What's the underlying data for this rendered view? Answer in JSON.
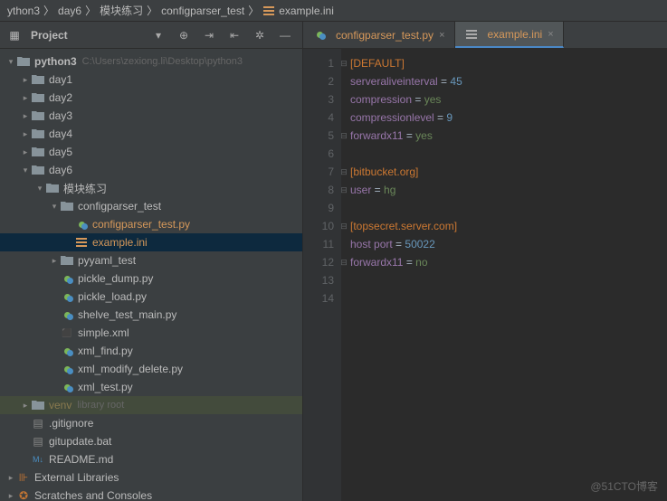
{
  "breadcrumb": {
    "items": [
      "ython3",
      "day6",
      "模块练习",
      "configparser_test"
    ],
    "active": "example.ini"
  },
  "sidebar": {
    "title": "Project",
    "root": {
      "name": "python3",
      "path": "C:\\Users\\zexiong.li\\Desktop\\python3"
    },
    "days": [
      "day1",
      "day2",
      "day3",
      "day4",
      "day5"
    ],
    "day6": "day6",
    "mod_folder": "模块练习",
    "cfg_folder": "configparser_test",
    "cfg_py": "configparser_test.py",
    "cfg_ini": "example.ini",
    "pyyaml": "pyyaml_test",
    "files": [
      "pickle_dump.py",
      "pickle_load.py",
      "shelve_test_main.py",
      "simple.xml",
      "xml_find.py",
      "xml_modify_delete.py",
      "xml_test.py"
    ],
    "venv": "venv",
    "venv_note": "library root",
    "dotfiles": [
      ".gitignore",
      "gitupdate.bat",
      "README.md"
    ],
    "ext_lib": "External Libraries",
    "scratches": "Scratches and Consoles"
  },
  "tabs": {
    "t1": "configparser_test.py",
    "t2": "example.ini"
  },
  "code": {
    "l1": {
      "section": "[DEFAULT]"
    },
    "l2": {
      "k": "serveraliveinterval",
      "eq": " = ",
      "v": "45"
    },
    "l3": {
      "k": "compression",
      "eq": " = ",
      "v": "yes"
    },
    "l4": {
      "k": "compressionlevel",
      "eq": " = ",
      "v": "9"
    },
    "l5": {
      "k": "forwardx11",
      "eq": " = ",
      "v": "yes"
    },
    "l7": {
      "section": "[bitbucket.org]"
    },
    "l8": {
      "k": "user",
      "eq": " = ",
      "v": "hg"
    },
    "l10": {
      "section": "[topsecret.server.com]"
    },
    "l11": {
      "k": "host port",
      "eq": " = ",
      "v": "50022"
    },
    "l12": {
      "k": "forwardx11",
      "eq": " = ",
      "v": "no"
    }
  },
  "gutter": [
    "1",
    "2",
    "3",
    "4",
    "5",
    "6",
    "7",
    "8",
    "9",
    "10",
    "11",
    "12",
    "13",
    "14"
  ],
  "watermark": "@51CTO博客"
}
